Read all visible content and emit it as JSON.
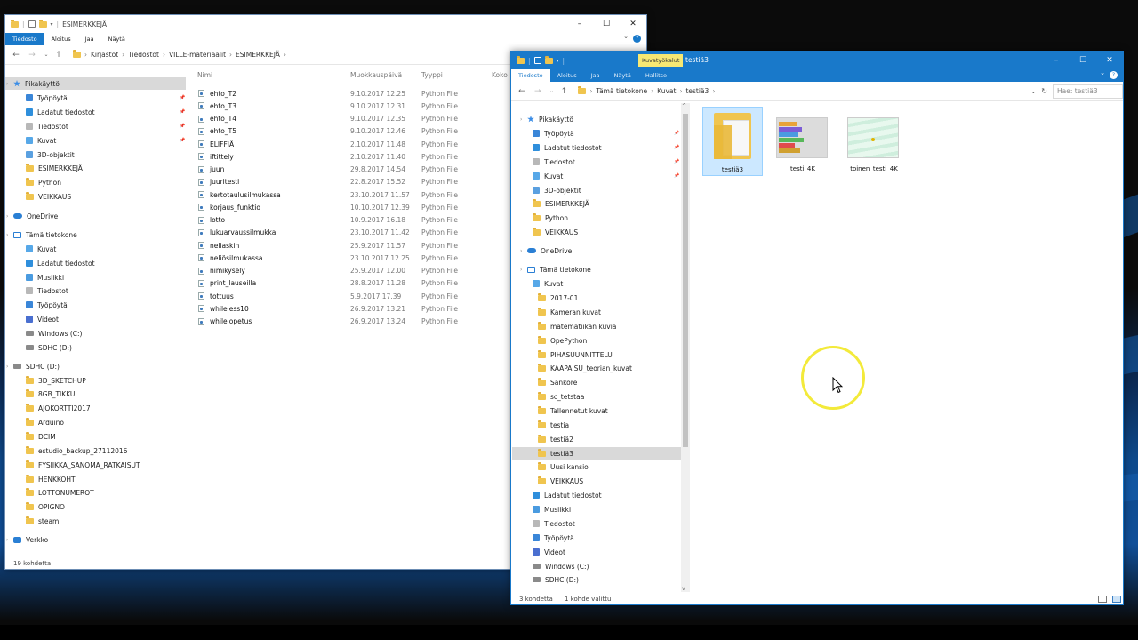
{
  "left_window": {
    "title": "ESIMERKKEJÄ",
    "ribbon_tabs": [
      "Tiedosto",
      "Aloitus",
      "Jaa",
      "Näytä"
    ],
    "breadcrumb": [
      "Kirjastot",
      "Tiedostot",
      "VILLE-materiaalit",
      "ESIMERKKEJÄ"
    ],
    "columns": {
      "name": "Nimi",
      "modified": "Muokkauspäivä",
      "type": "Tyyppi",
      "size": "Koko"
    },
    "nav": [
      {
        "label": "Pikakäyttö",
        "icon": "star-icon",
        "level": 0,
        "selected": true
      },
      {
        "label": "Työpöytä",
        "icon": "desktop-icon",
        "level": 1,
        "pinned": true
      },
      {
        "label": "Ladatut tiedostot",
        "icon": "downloads-icon",
        "level": 1,
        "pinned": true
      },
      {
        "label": "Tiedostot",
        "icon": "documents-icon",
        "level": 1,
        "pinned": true
      },
      {
        "label": "Kuvat",
        "icon": "pictures-icon",
        "level": 1,
        "pinned": true
      },
      {
        "label": "3D-objektit",
        "icon": "3d-objects-icon",
        "level": 1
      },
      {
        "label": "ESIMERKKEJÄ",
        "icon": "folder-icon",
        "level": 1
      },
      {
        "label": "Python",
        "icon": "folder-icon",
        "level": 1
      },
      {
        "label": "VEIKKAUS",
        "icon": "folder-icon",
        "level": 1
      },
      {
        "label": "OneDrive",
        "icon": "cloud-icon",
        "level": 0,
        "gap": true
      },
      {
        "label": "Tämä tietokone",
        "icon": "pc-icon",
        "level": 0,
        "gap": true
      },
      {
        "label": "Kuvat",
        "icon": "pictures-icon",
        "level": 1
      },
      {
        "label": "Ladatut tiedostot",
        "icon": "downloads-icon",
        "level": 1
      },
      {
        "label": "Musiikki",
        "icon": "music-icon",
        "level": 1
      },
      {
        "label": "Tiedostot",
        "icon": "documents-icon",
        "level": 1
      },
      {
        "label": "Työpöytä",
        "icon": "desktop-icon",
        "level": 1
      },
      {
        "label": "Videot",
        "icon": "videos-icon",
        "level": 1
      },
      {
        "label": "Windows (C:)",
        "icon": "drive-icon",
        "level": 1
      },
      {
        "label": "SDHC (D:)",
        "icon": "drive-icon",
        "level": 1
      },
      {
        "label": "SDHC (D:)",
        "icon": "drive-icon",
        "level": 0,
        "gap": true
      },
      {
        "label": "3D_SKETCHUP",
        "icon": "folder-icon",
        "level": 1
      },
      {
        "label": "8GB_TIKKU",
        "icon": "folder-icon",
        "level": 1
      },
      {
        "label": "AJOKORTTI2017",
        "icon": "folder-icon",
        "level": 1
      },
      {
        "label": "Arduino",
        "icon": "folder-icon",
        "level": 1
      },
      {
        "label": "DCIM",
        "icon": "folder-icon",
        "level": 1
      },
      {
        "label": "estudio_backup_27112016",
        "icon": "folder-icon",
        "level": 1
      },
      {
        "label": "FYSIIKKA_SANOMA_RATKAISUT",
        "icon": "folder-icon",
        "level": 1
      },
      {
        "label": "HENKKOHT",
        "icon": "folder-icon",
        "level": 1
      },
      {
        "label": "LOTTONUMEROT",
        "icon": "folder-icon",
        "level": 1
      },
      {
        "label": "OPIGNO",
        "icon": "folder-icon",
        "level": 1
      },
      {
        "label": "steam",
        "icon": "folder-icon",
        "level": 1
      },
      {
        "label": "Verkko",
        "icon": "network-icon",
        "level": 0,
        "gap": true
      }
    ],
    "files": [
      {
        "name": "ehto_T2",
        "date": "9.10.2017 12.25",
        "type": "Python File"
      },
      {
        "name": "ehto_T3",
        "date": "9.10.2017 12.31",
        "type": "Python File"
      },
      {
        "name": "ehto_T4",
        "date": "9.10.2017 12.35",
        "type": "Python File"
      },
      {
        "name": "ehto_T5",
        "date": "9.10.2017 12.46",
        "type": "Python File"
      },
      {
        "name": "ELIFFIÄ",
        "date": "2.10.2017 11.48",
        "type": "Python File"
      },
      {
        "name": "iftittely",
        "date": "2.10.2017 11.40",
        "type": "Python File"
      },
      {
        "name": "juun",
        "date": "29.8.2017 14.54",
        "type": "Python File"
      },
      {
        "name": "juuritesti",
        "date": "22.8.2017 15.52",
        "type": "Python File"
      },
      {
        "name": "kertotaulusilmukassa",
        "date": "23.10.2017 11.57",
        "type": "Python File"
      },
      {
        "name": "korjaus_funktio",
        "date": "10.10.2017 12.39",
        "type": "Python File"
      },
      {
        "name": "lotto",
        "date": "10.9.2017 16.18",
        "type": "Python File"
      },
      {
        "name": "lukuarvaussilmukka",
        "date": "23.10.2017 11.42",
        "type": "Python File"
      },
      {
        "name": "neliaskin",
        "date": "25.9.2017 11.57",
        "type": "Python File"
      },
      {
        "name": "neliösilmukassa",
        "date": "23.10.2017 12.25",
        "type": "Python File"
      },
      {
        "name": "nimikysely",
        "date": "25.9.2017 12.00",
        "type": "Python File"
      },
      {
        "name": "print_lauseilla",
        "date": "28.8.2017 11.28",
        "type": "Python File"
      },
      {
        "name": "tottuus",
        "date": "5.9.2017 17.39",
        "type": "Python File"
      },
      {
        "name": "whileless10",
        "date": "26.9.2017 13.21",
        "type": "Python File"
      },
      {
        "name": "whilelopetus",
        "date": "26.9.2017 13.24",
        "type": "Python File"
      }
    ],
    "status": "19 kohdetta"
  },
  "right_window": {
    "title": "testiä3",
    "contextual_tab": "Kuvatyökalut",
    "ribbon_tabs": [
      "Tiedosto",
      "Aloitus",
      "Jaa",
      "Näytä",
      "Hallitse"
    ],
    "breadcrumb": [
      "Tämä tietokone",
      "Kuvat",
      "testiä3"
    ],
    "search_placeholder": "Hae: testiä3",
    "nav": [
      {
        "label": "Pikakäyttö",
        "icon": "star-icon",
        "level": 0
      },
      {
        "label": "Työpöytä",
        "icon": "desktop-icon",
        "level": 1,
        "pinned": true
      },
      {
        "label": "Ladatut tiedostot",
        "icon": "downloads-icon",
        "level": 1,
        "pinned": true
      },
      {
        "label": "Tiedostot",
        "icon": "documents-icon",
        "level": 1,
        "pinned": true
      },
      {
        "label": "Kuvat",
        "icon": "pictures-icon",
        "level": 1,
        "pinned": true
      },
      {
        "label": "3D-objektit",
        "icon": "3d-objects-icon",
        "level": 1
      },
      {
        "label": "ESIMERKKEJÄ",
        "icon": "folder-icon",
        "level": 1
      },
      {
        "label": "Python",
        "icon": "folder-icon",
        "level": 1
      },
      {
        "label": "VEIKKAUS",
        "icon": "folder-icon",
        "level": 1
      },
      {
        "label": "OneDrive",
        "icon": "cloud-icon",
        "level": 0,
        "gap": true
      },
      {
        "label": "Tämä tietokone",
        "icon": "pc-icon",
        "level": 0,
        "gap": true
      },
      {
        "label": "Kuvat",
        "icon": "pictures-icon",
        "level": 1
      },
      {
        "label": "2017-01",
        "icon": "folder-icon",
        "level": 2
      },
      {
        "label": "Kameran kuvat",
        "icon": "folder-icon",
        "level": 2
      },
      {
        "label": "matematiikan kuvia",
        "icon": "folder-icon",
        "level": 2
      },
      {
        "label": "OpePython",
        "icon": "folder-icon",
        "level": 2
      },
      {
        "label": "PIHASUUNNITTELU",
        "icon": "folder-icon",
        "level": 2
      },
      {
        "label": "KAAPAISU_teorian_kuvat",
        "icon": "folder-icon",
        "level": 2
      },
      {
        "label": "Sankore",
        "icon": "folder-icon",
        "level": 2
      },
      {
        "label": "sc_tetstaa",
        "icon": "folder-icon",
        "level": 2
      },
      {
        "label": "Tallennetut kuvat",
        "icon": "folder-icon",
        "level": 2
      },
      {
        "label": "testia",
        "icon": "folder-icon",
        "level": 2
      },
      {
        "label": "testiä2",
        "icon": "folder-icon",
        "level": 2
      },
      {
        "label": "testiä3",
        "icon": "folder-icon",
        "level": 2,
        "selected": true
      },
      {
        "label": "Uusi kansio",
        "icon": "folder-icon",
        "level": 2
      },
      {
        "label": "VEIKKAUS",
        "icon": "folder-icon",
        "level": 2
      },
      {
        "label": "Ladatut tiedostot",
        "icon": "downloads-icon",
        "level": 1
      },
      {
        "label": "Musiikki",
        "icon": "music-icon",
        "level": 1
      },
      {
        "label": "Tiedostot",
        "icon": "documents-icon",
        "level": 1
      },
      {
        "label": "Työpöytä",
        "icon": "desktop-icon",
        "level": 1
      },
      {
        "label": "Videot",
        "icon": "videos-icon",
        "level": 1
      },
      {
        "label": "Windows (C:)",
        "icon": "drive-icon",
        "level": 1
      },
      {
        "label": "SDHC (D:)",
        "icon": "drive-icon",
        "level": 1
      }
    ],
    "items": [
      {
        "name": "testiä3",
        "kind": "folder",
        "selected": true
      },
      {
        "name": "testi_4K",
        "kind": "image-blocks"
      },
      {
        "name": "toinen_testi_4K",
        "kind": "image-waves"
      }
    ],
    "status_count": "3 kohdetta",
    "status_selected": "1 kohde valittu"
  },
  "colors": {
    "accent": "#1979ca",
    "contextual": "#f7e873",
    "selected_row": "#d9d9d9",
    "selected_item": "#cce8ff",
    "folder": "#f0c54f"
  }
}
